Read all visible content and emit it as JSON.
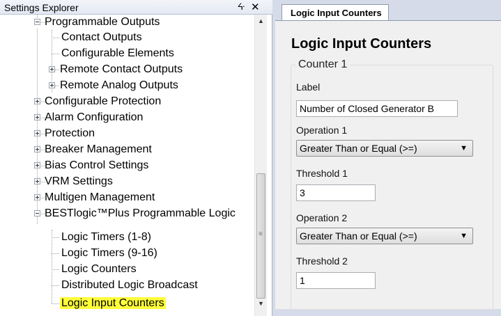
{
  "explorer": {
    "title": "Settings Explorer",
    "pin_glyph": "ᔰ",
    "close_glyph": "✕",
    "tree": [
      {
        "label": "Programmable Outputs",
        "expanded": true
      },
      {
        "label": "Contact Outputs"
      },
      {
        "label": "Configurable Elements"
      },
      {
        "label": "Remote Contact Outputs",
        "expanded": false
      },
      {
        "label": "Remote Analog Outputs",
        "expanded": false
      },
      {
        "label": "Configurable Protection",
        "expanded": false
      },
      {
        "label": "Alarm Configuration",
        "expanded": false
      },
      {
        "label": "Protection",
        "expanded": false
      },
      {
        "label": "Breaker Management",
        "expanded": false
      },
      {
        "label": "Bias Control Settings",
        "expanded": false
      },
      {
        "label": "VRM Settings",
        "expanded": false
      },
      {
        "label": "Multigen Management",
        "expanded": false
      },
      {
        "label": "BESTlogic™Plus Programmable Logic",
        "expanded": true
      },
      {
        "label": "Logic Timers (1-8)"
      },
      {
        "label": "Logic Timers (9-16)"
      },
      {
        "label": "Logic Counters"
      },
      {
        "label": "Distributed Logic Broadcast"
      },
      {
        "label": "Logic Input Counters",
        "selected": true
      }
    ]
  },
  "tab": {
    "label": "Logic Input Counters"
  },
  "page": {
    "title": "Logic Input Counters",
    "group_title": "Counter 1",
    "label_caption": "Label",
    "label_value": "Number of Closed Generator B",
    "operation1_caption": "Operation 1",
    "operation1_value": "Greater Than or Equal (>=)",
    "threshold1_caption": "Threshold 1",
    "threshold1_value": "3",
    "operation2_caption": "Operation 2",
    "operation2_value": "Greater Than or Equal (>=)",
    "threshold2_caption": "Threshold 2",
    "threshold2_value": "1"
  },
  "colors": {
    "selection_highlight": "#ffff3a",
    "panel_background": "#f0f0f0",
    "chrome": "#d6dbe9"
  }
}
